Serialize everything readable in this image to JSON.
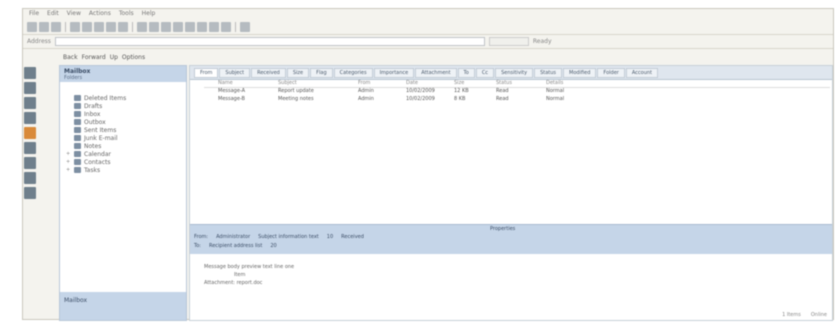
{
  "menubar": [
    "File",
    "Edit",
    "View",
    "Actions",
    "Tools",
    "Help"
  ],
  "toolbar": {
    "address_label": "Address",
    "go_status": "Ready"
  },
  "toolbar3": [
    "Back",
    "Forward",
    "Up",
    "Options"
  ],
  "nav": {
    "header_title": "Mailbox",
    "header_sub": "Folders",
    "items": [
      {
        "label": "Deleted Items",
        "level": 1
      },
      {
        "label": "Drafts",
        "level": 1
      },
      {
        "label": "Inbox",
        "level": 1
      },
      {
        "label": "Outbox",
        "level": 1
      },
      {
        "label": "Sent Items",
        "level": 1
      },
      {
        "label": "Junk E-mail",
        "level": 1
      },
      {
        "label": "Notes",
        "level": 1
      },
      {
        "label": "Calendar",
        "level": 2
      },
      {
        "label": "Contacts",
        "level": 2
      },
      {
        "label": "Tasks",
        "level": 2
      }
    ],
    "footer": "Mailbox"
  },
  "tabs": [
    "From",
    "Subject",
    "Received",
    "Size",
    "Flag",
    "Categories",
    "Importance",
    "Attachment",
    "To",
    "Cc",
    "Sensitivity",
    "Status",
    "Modified",
    "Folder",
    "Account"
  ],
  "grid": {
    "headers": [
      "",
      "Name",
      "Subject",
      "From",
      "Date",
      "Size",
      "Status",
      "Details"
    ],
    "rows": [
      [
        "",
        "Message-A",
        "Report update",
        "Admin",
        "10/02/2009",
        "12 KB",
        "Read",
        "Normal"
      ],
      [
        "",
        "Message-B",
        "Meeting notes",
        "Admin",
        "10/02/2009",
        "8 KB",
        "Read",
        "Normal"
      ]
    ]
  },
  "detail": {
    "title": "Properties",
    "line1": [
      "From:",
      "Administrator",
      "Subject information text",
      "10",
      "Received"
    ],
    "line2": [
      "To:",
      "Recipient address list",
      "20"
    ]
  },
  "preview": {
    "lines": [
      "Message body preview text line one",
      "Item",
      "Attachment: report.doc"
    ]
  },
  "status": {
    "left": "1 Items",
    "right": "Online"
  }
}
